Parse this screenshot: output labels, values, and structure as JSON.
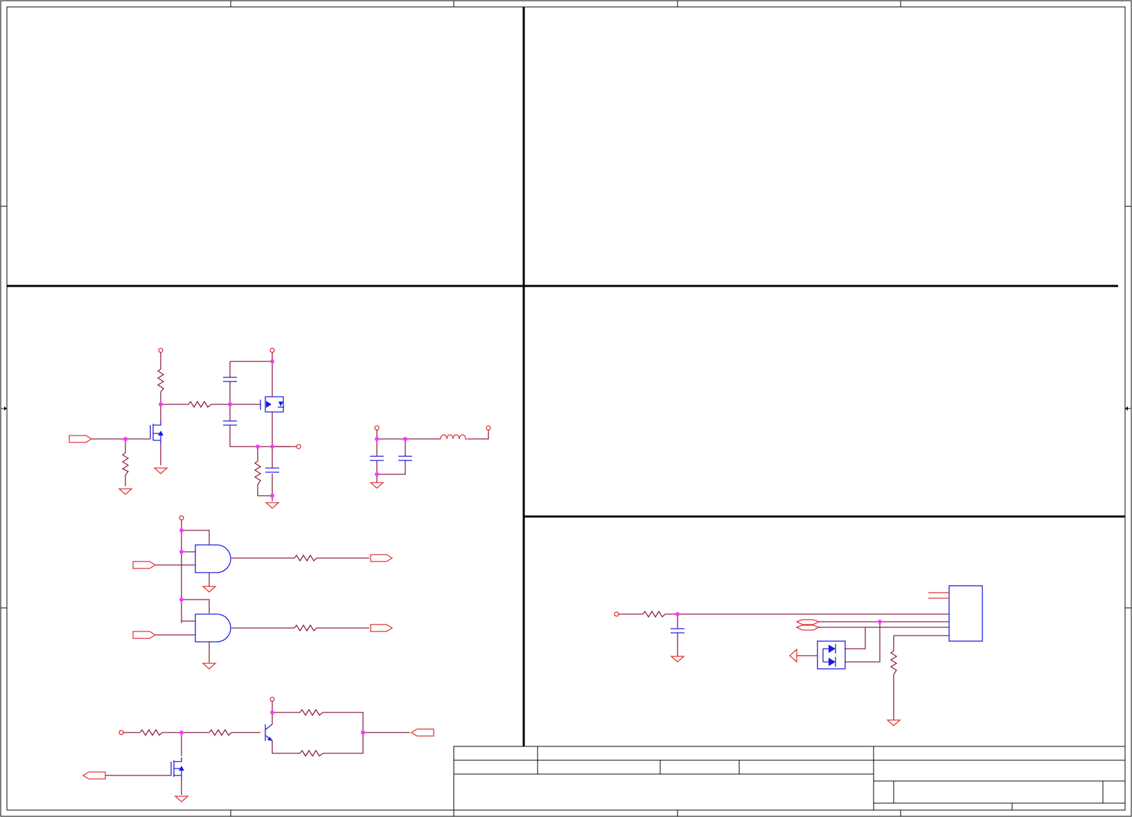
{
  "sheet": {
    "background": "#ffffff",
    "frame_color": "#000000",
    "wire_color": "#8b1f3f",
    "component_color": "#e03232",
    "symbol_color": "#1a1ae0",
    "junction_color": "#ff33ff"
  },
  "title_block": {
    "title": "",
    "size": "",
    "document_number": "",
    "revision": "",
    "date": "",
    "sheet": ""
  }
}
